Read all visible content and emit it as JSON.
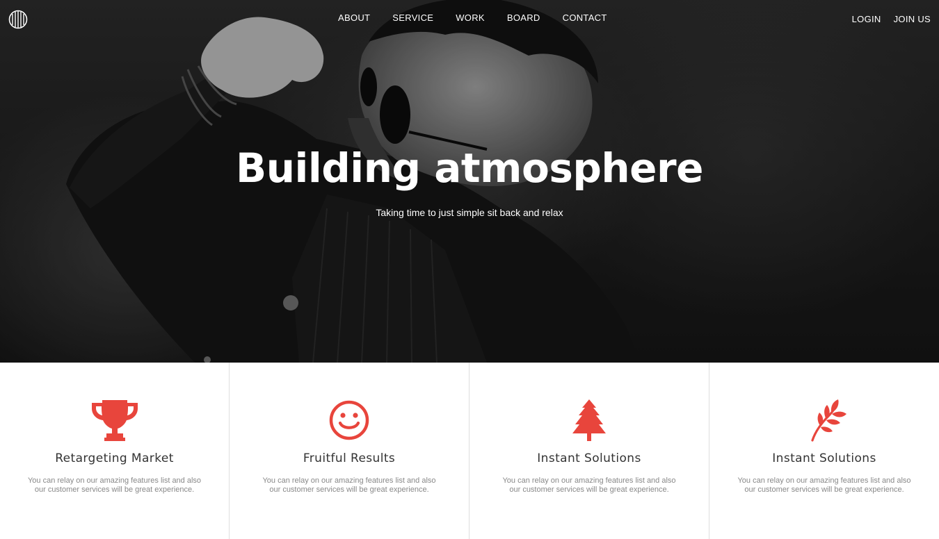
{
  "nav": {
    "items": [
      {
        "label": "ABOUT"
      },
      {
        "label": "SERVICE"
      },
      {
        "label": "WORK"
      },
      {
        "label": "BOARD"
      },
      {
        "label": "CONTACT"
      }
    ],
    "login": "LOGIN",
    "join": "JOIN US"
  },
  "hero": {
    "title": "Building atmosphere",
    "subtitle": "Taking time to just simple sit back and relax"
  },
  "features": [
    {
      "icon": "trophy-icon",
      "title": "Retargeting Market",
      "text": "You can relay on our amazing features list and also our customer services will be great experience."
    },
    {
      "icon": "smiley-icon",
      "title": "Fruitful Results",
      "text": "You can relay on our amazing features list and also our customer services will be great experience."
    },
    {
      "icon": "tree-icon",
      "title": "Instant Solutions",
      "text": "You can relay on our amazing features list and also our customer services will be great experience."
    },
    {
      "icon": "leaf-branch-icon",
      "title": "Instant Solutions",
      "text": "You can relay on our amazing features list and also our customer services will be great experience."
    }
  ],
  "colors": {
    "accent": "#e8453c",
    "text_dark": "#333333",
    "text_muted": "#888888"
  }
}
